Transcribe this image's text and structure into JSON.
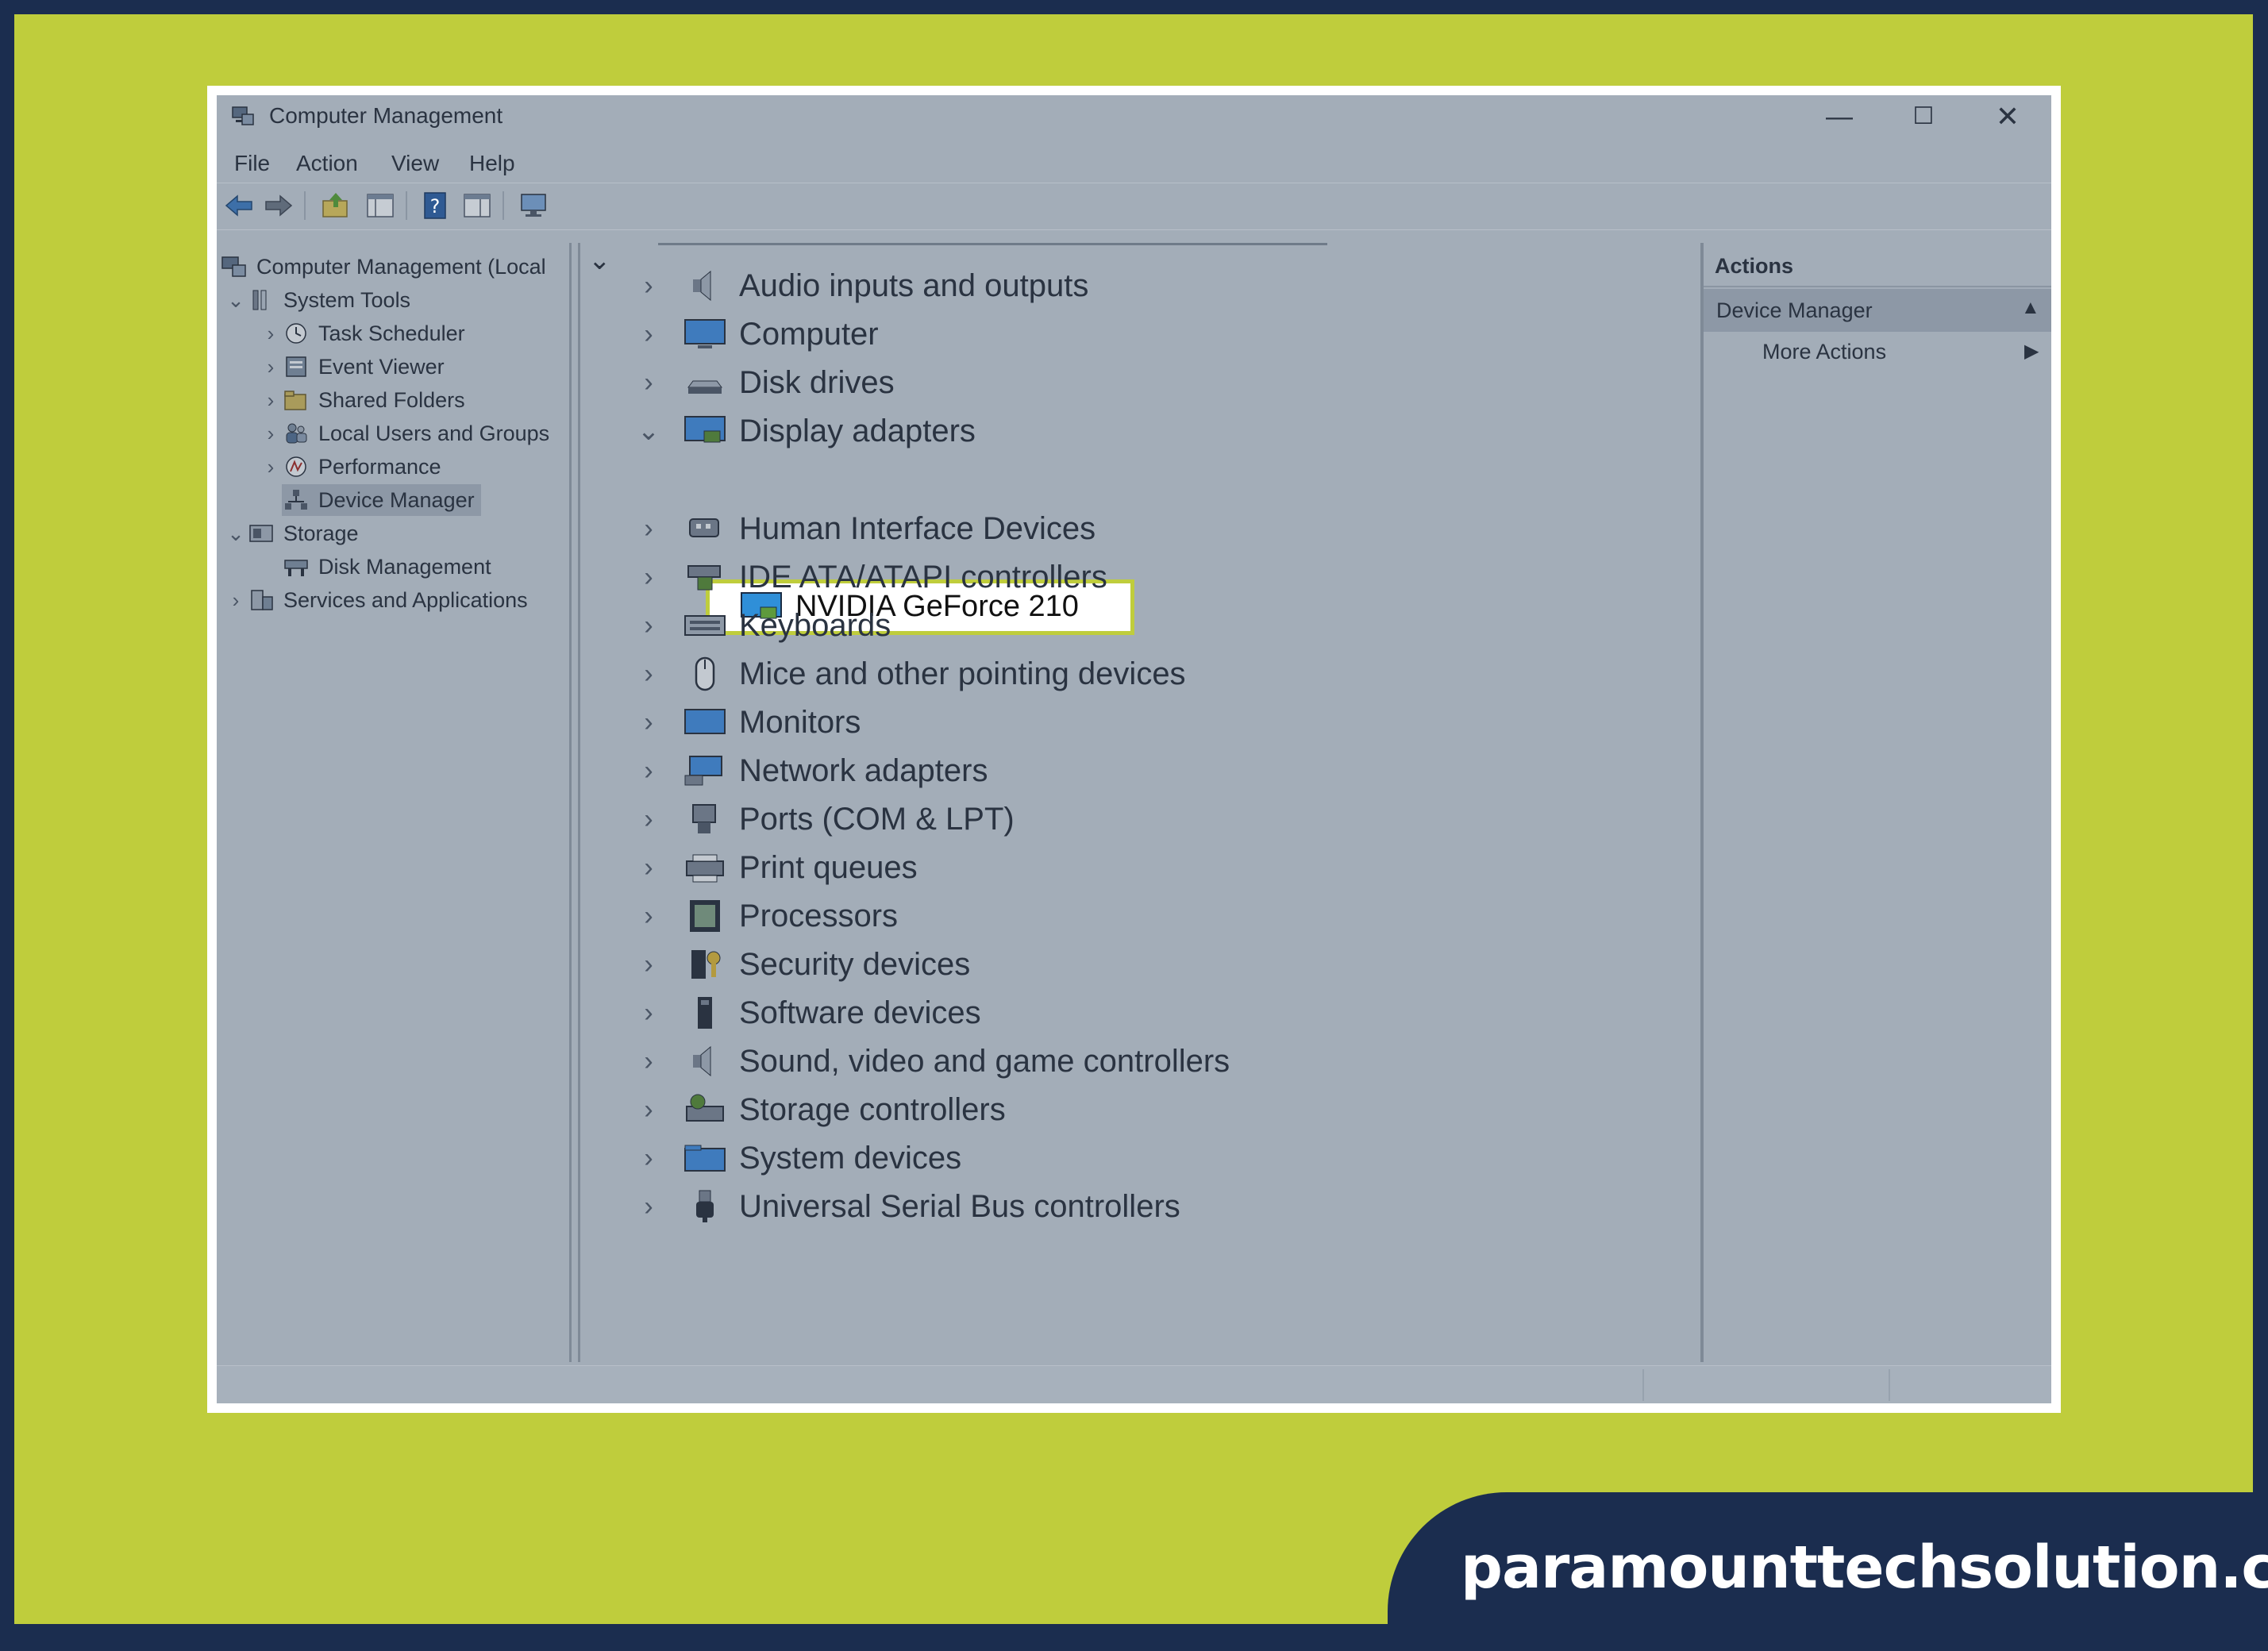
{
  "window": {
    "title": "Computer Management",
    "controls": {
      "minimize": "—",
      "maximize": "☐",
      "close": "✕"
    }
  },
  "menu": [
    "File",
    "Action",
    "View",
    "Help"
  ],
  "toolbar": [
    "back-icon",
    "forward-icon",
    "up-folder-icon",
    "show-hide-tree-icon",
    "help-icon",
    "properties-icon",
    "computer-icon"
  ],
  "tree": {
    "items": [
      {
        "label": "Computer Management (Local",
        "icon": "computer-management-icon"
      },
      {
        "label": "System Tools",
        "icon": "tools-icon"
      },
      {
        "label": "Task Scheduler",
        "icon": "clock-icon"
      },
      {
        "label": "Event Viewer",
        "icon": "event-viewer-icon"
      },
      {
        "label": "Shared Folders",
        "icon": "shared-folder-icon"
      },
      {
        "label": "Local Users and Groups",
        "icon": "users-icon"
      },
      {
        "label": "Performance",
        "icon": "performance-icon"
      },
      {
        "label": "Device Manager",
        "icon": "device-manager-icon"
      },
      {
        "label": "Storage",
        "icon": "storage-icon"
      },
      {
        "label": "Disk Management",
        "icon": "disk-management-icon"
      },
      {
        "label": "Services and Applications",
        "icon": "services-icon"
      }
    ],
    "selected": "Device Manager"
  },
  "scroll": {
    "left": "<",
    "right": ">"
  },
  "devices": {
    "items": [
      {
        "label": "Audio inputs and outputs",
        "icon": "speaker-icon"
      },
      {
        "label": "Computer",
        "icon": "monitor-icon"
      },
      {
        "label": "Disk drives",
        "icon": "disk-drive-icon"
      },
      {
        "label": "Display adapters",
        "icon": "display-adapter-icon"
      },
      {
        "label": "Human Interface Devices",
        "icon": "hid-icon"
      },
      {
        "label": "IDE ATA/ATAPI controllers",
        "icon": "ide-controller-icon"
      },
      {
        "label": "Keyboards",
        "icon": "keyboard-icon"
      },
      {
        "label": "Mice and other pointing devices",
        "icon": "mouse-icon"
      },
      {
        "label": "Monitors",
        "icon": "monitor-icon"
      },
      {
        "label": "Network adapters",
        "icon": "network-icon"
      },
      {
        "label": "Ports (COM & LPT)",
        "icon": "port-icon"
      },
      {
        "label": "Print queues",
        "icon": "printer-icon"
      },
      {
        "label": "Processors",
        "icon": "processor-icon"
      },
      {
        "label": "Security devices",
        "icon": "security-icon"
      },
      {
        "label": "Software devices",
        "icon": "software-device-icon"
      },
      {
        "label": "Sound, video and game controllers",
        "icon": "speaker-icon"
      },
      {
        "label": "Storage controllers",
        "icon": "storage-controller-icon"
      },
      {
        "label": "System devices",
        "icon": "system-folder-icon"
      },
      {
        "label": "Universal Serial Bus controllers",
        "icon": "usb-icon"
      }
    ],
    "expanded_child": {
      "label": "NVIDIA GeForce 210",
      "icon": "display-adapter-icon"
    }
  },
  "actions": {
    "title": "Actions",
    "section": "Device Manager",
    "more": "More Actions"
  },
  "brand": "paramounttechsolution.com",
  "colors": {
    "frame_lime": "#bfcd3c",
    "navy": "#1b2d4f",
    "highlight_border": "#bfcd3c"
  }
}
